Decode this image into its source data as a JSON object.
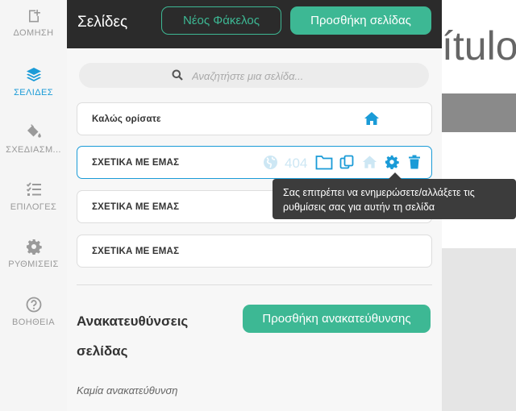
{
  "rail": {
    "items": [
      {
        "label": "ΔΟΜΗΣΗ",
        "icon": "add-page-icon",
        "active": false
      },
      {
        "label": "ΣΕΛΙΔΕΣ",
        "icon": "layers-icon",
        "active": true
      },
      {
        "label": "ΣΧΕΔΙΑΣΜ...",
        "icon": "paint-bucket-icon",
        "active": false
      },
      {
        "label": "ΕΠΙΛΟΓΕΣ",
        "icon": "checklist-icon",
        "active": false
      },
      {
        "label": "ΡΥΘΜΙΣΕΙΣ",
        "icon": "gear-icon",
        "active": false
      },
      {
        "label": "ΒΟΗΘΕΙΑ",
        "icon": "help-icon",
        "active": false
      }
    ]
  },
  "panel": {
    "title": "Σελίδες",
    "new_folder_label": "Νέος Φάκελος",
    "add_page_label": "Προσθήκη σελίδας",
    "search_placeholder": "Αναζητήστε μια σελίδα...",
    "pages": [
      {
        "name": "Καλώς ορίσατε",
        "home": true
      },
      {
        "name": "ΣΧΕΤΙΚΑ ΜΕ ΕΜΑΣ",
        "selected": true,
        "status_code": "404"
      },
      {
        "name": "ΣΧΕΤΙΚΑ ΜΕ ΕΜΑΣ"
      },
      {
        "name": "ΣΧΕΤΙΚΑ ΜΕ ΕΜΑΣ"
      }
    ],
    "redirects_title": "Ανακατευθύνσεις σελίδας",
    "add_redirect_label": "Προσθήκη ανακατεύθυνσης",
    "no_redirect_text": "Καμία ανακατεύθυνση"
  },
  "tooltip": {
    "text": "Σας επιτρέπει να ενημερώσετε/αλλάξετε τις ρυθμίσεις σας για αυτήν τη σελίδα"
  },
  "canvas": {
    "title_fragment": "ítulo"
  },
  "colors": {
    "accent_green": "#3db894",
    "accent_blue": "#1a9bd7",
    "header_dark": "#2b2b2b",
    "tooltip_bg": "#3c3c3c",
    "delete_blue": "#1a9bd7"
  }
}
